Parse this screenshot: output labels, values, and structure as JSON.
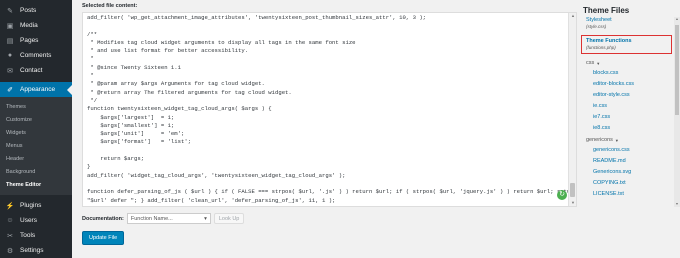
{
  "sidebar": {
    "items": [
      {
        "label": "Posts",
        "icon": "pushpin-icon"
      },
      {
        "label": "Media",
        "icon": "media-icon"
      },
      {
        "label": "Pages",
        "icon": "pages-icon"
      },
      {
        "label": "Comments",
        "icon": "comments-icon"
      },
      {
        "label": "Contact",
        "icon": "mail-icon"
      }
    ],
    "active": {
      "label": "Appearance",
      "icon": "appearance-icon"
    },
    "submenu": [
      "Themes",
      "Customize",
      "Widgets",
      "Menus",
      "Header",
      "Background",
      "Theme Editor"
    ],
    "after": [
      {
        "label": "Plugins",
        "icon": "plugins-icon"
      },
      {
        "label": "Users",
        "icon": "users-icon"
      },
      {
        "label": "Tools",
        "icon": "tools-icon"
      },
      {
        "label": "Settings",
        "icon": "settings-icon"
      }
    ]
  },
  "editor": {
    "label": "Selected file content:",
    "code": "add_filter( 'wp_get_attachment_image_attributes', 'twentysixteen_post_thumbnail_sizes_attr', 10, 3 );\n\n/**\n * Modifies tag cloud widget arguments to display all tags in the same font size\n * and use list format for better accessibility.\n *\n * @since Twenty Sixteen 1.1\n *\n * @param array $args Arguments for tag cloud widget.\n * @return array The filtered arguments for tag cloud widget.\n */\nfunction twentysixteen_widget_tag_cloud_args( $args ) {\n    $args['largest']  = 1;\n    $args['smallest'] = 1;\n    $args['unit']     = 'em';\n    $args['format']   = 'list';\n\n    return $args;\n}\nadd_filter( 'widget_tag_cloud_args', 'twentysixteen_widget_tag_cloud_args' );\n\nfunction defer_parsing_of_js ( $url ) { if ( FALSE === strpos( $url, '.js' ) ) return $url; if ( strpos( $url, 'jquery.js' ) ) return $url; return\n\"$url' defer \"; } add_filter( 'clean_url', 'defer_parsing_of_js', 11, 1 );"
  },
  "documentation": {
    "label": "Documentation:",
    "select_value": "Function Name...",
    "lookup_label": "Look Up"
  },
  "update_button": "Update File",
  "theme_files": {
    "title": "Theme Files",
    "stylesheet": {
      "name": "Stylesheet",
      "file": "(style.css)"
    },
    "functions": {
      "name": "Theme Functions",
      "file": "(functions.php)"
    },
    "css_folder": "css",
    "css_files": [
      "blocks.css",
      "editor-blocks.css",
      "editor-style.css",
      "ie.css",
      "ie7.css",
      "ie8.css"
    ],
    "genericons_folder": "genericons",
    "genericons_files": [
      "genericons.css",
      "README.md",
      "Genericons.svg",
      "COPYING.txt",
      "LICENSE.txt"
    ]
  }
}
